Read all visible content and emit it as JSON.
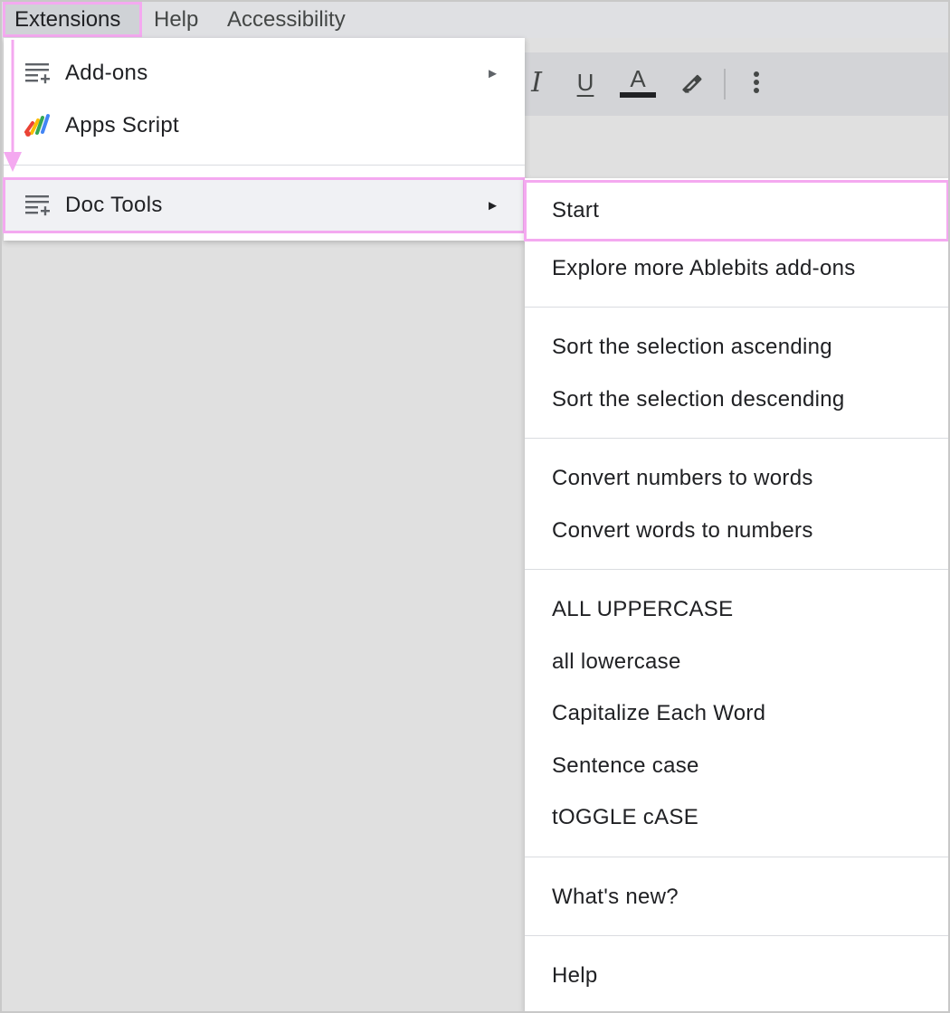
{
  "menubar": {
    "extensions": "Extensions",
    "help": "Help",
    "accessibility": "Accessibility"
  },
  "toolbar": {
    "italic": "I",
    "underline": "U",
    "text_color": "A"
  },
  "menu": {
    "items": [
      {
        "label": "Add-ons",
        "icon": "add-ons-icon",
        "arrow": "►"
      },
      {
        "label": "Apps Script",
        "icon": "apps-script-icon"
      },
      {
        "label": "Doc Tools",
        "icon": "add-ons-icon",
        "arrow": "►"
      }
    ]
  },
  "submenu": {
    "items": [
      "Start",
      "Explore more Ablebits add-ons",
      "Sort the selection ascending",
      "Sort the selection descending",
      "Convert numbers to words",
      "Convert words to numbers",
      "ALL UPPERCASE",
      "all lowercase",
      "Capitalize Each Word",
      "Sentence case",
      "tOGGLE cASE",
      "What's new?",
      "Help"
    ]
  },
  "colors": {
    "highlight_outline": "#f4a9f0",
    "menubar_bg": "#dfe0e3",
    "page_bg": "#e0e0e0"
  }
}
